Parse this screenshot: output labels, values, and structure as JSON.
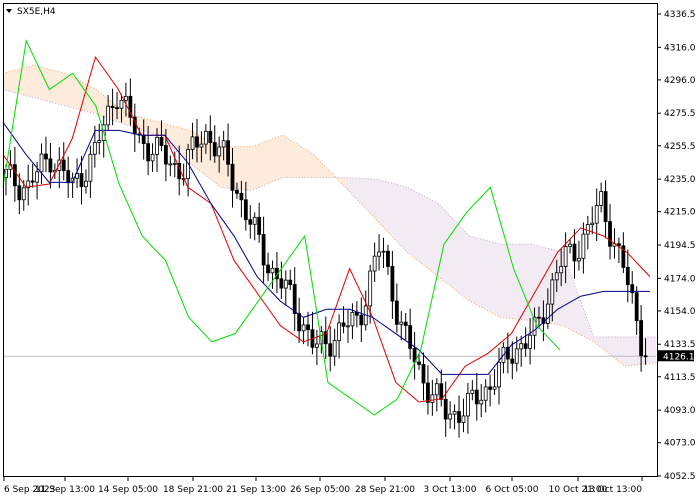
{
  "window": {
    "symbol_label": "SX5E,H4"
  },
  "price_scale": {
    "ticks": [
      "4336.5",
      "4316.0",
      "4296.0",
      "4275.5",
      "4255.5",
      "4235.0",
      "4215.0",
      "4194.5",
      "4174.0",
      "4154.0",
      "4133.5",
      "4113.5",
      "4093.0",
      "4073.0",
      "4052.5"
    ],
    "current_price": "4126.1"
  },
  "time_scale": {
    "ticks": [
      "6 Sep 2023",
      "11 Sep 13:00",
      "14 Sep 05:00",
      "18 Sep 21:00",
      "21 Sep 13:00",
      "26 Sep 05:00",
      "28 Sep 21:00",
      "3 Oct 13:00",
      "6 Oct 05:00",
      "10 Oct 21:00",
      "13 Oct 13:00"
    ]
  },
  "colors": {
    "background": "#ffffff",
    "frame": "#000000",
    "candle": "#000000",
    "tenkan": "#dd0000",
    "kijun": "#00008b",
    "chikou": "#00dd00",
    "span_a": "#f4a460",
    "span_b": "#c8a2c8",
    "bid_line": "#c0c0c0"
  },
  "chart_data": {
    "type": "line",
    "title": "SX5E,H4",
    "indicator": "Ichimoku Kinko Hyo",
    "ylim": [
      4052.5,
      4336.5
    ],
    "last_price": 4126.1,
    "x": [
      "6 Sep 2023",
      "11 Sep 13:00",
      "14 Sep 05:00",
      "18 Sep 21:00",
      "21 Sep 13:00",
      "26 Sep 05:00",
      "28 Sep 21:00",
      "3 Oct 13:00",
      "6 Oct 05:00",
      "10 Oct 21:00",
      "13 Oct 13:00"
    ],
    "candles_close_approx": [
      4236,
      4230,
      4250,
      4230,
      4250,
      4290,
      4260,
      4250,
      4240,
      4265,
      4245,
      4210,
      4180,
      4160,
      4130,
      4140,
      4150,
      4195,
      4140,
      4110,
      4090,
      4095,
      4110,
      4130,
      4140,
      4180,
      4195,
      4220,
      4180,
      4126.1
    ],
    "series": [
      {
        "name": "tenkan",
        "values": [
          4250,
          4230,
          4232,
          4260,
          4310,
          4290,
          4262,
          4262,
          4230,
          4220,
          4185,
          4165,
          4145,
          4135,
          4140,
          4180,
          4150,
          4110,
          4098,
          4100,
          4120,
          4128,
          4140,
          4165,
          4190,
          4205,
          4200,
          4190,
          4175
        ]
      },
      {
        "name": "kijun",
        "values": [
          4270,
          4250,
          4233,
          4233,
          4265,
          4265,
          4262,
          4262,
          4245,
          4220,
          4200,
          4175,
          4160,
          4150,
          4155,
          4155,
          4150,
          4140,
          4130,
          4115,
          4115,
          4115,
          4133,
          4142,
          4155,
          4163,
          4166,
          4166,
          4166
        ]
      },
      {
        "name": "chikou",
        "values": [
          4230,
          4320,
          4290,
          4300,
          4280,
          4232,
          4200,
          4185,
          4150,
          4135,
          4140,
          4160,
          4180,
          4200,
          4110,
          4100,
          4090,
          4100,
          4130,
          4195,
          4215,
          4230,
          4180,
          4145,
          4130
        ]
      }
    ],
    "cloud": {
      "span_a": [
        4300,
        4305,
        4300,
        4290,
        4275,
        4270,
        4265,
        4255,
        4255,
        4262,
        4250,
        4230,
        4210,
        4190,
        4175,
        4160,
        4150,
        4148,
        4145,
        4135,
        4120,
        4122
      ],
      "span_b": [
        4290,
        4285,
        4280,
        4275,
        4268,
        4262,
        4245,
        4230,
        4228,
        4236,
        4236,
        4236,
        4235,
        4230,
        4220,
        4200,
        4195,
        4195,
        4190,
        4138,
        4138,
        4138
      ]
    }
  }
}
